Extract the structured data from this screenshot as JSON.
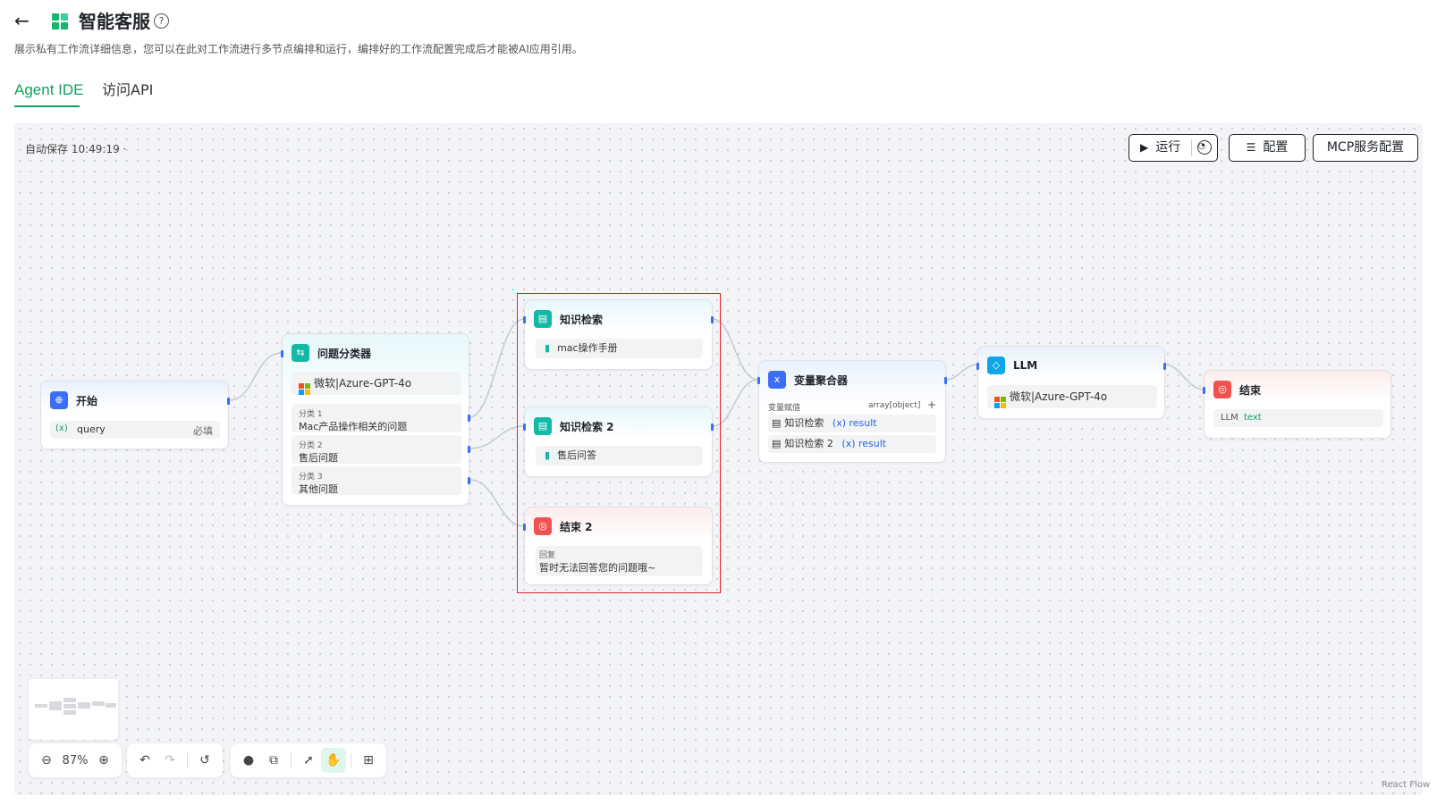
{
  "header": {
    "back_label": "←",
    "title": "智能客服",
    "help_label": "?",
    "description": "展示私有工作流详细信息，您可以在此对工作流进行多节点编排和运行，编排好的工作流配置完成后才能被AI应用引用。"
  },
  "tabs": [
    {
      "label": "Agent IDE",
      "active": true
    },
    {
      "label": "访问API",
      "active": false
    }
  ],
  "canvas": {
    "autosave": "自动保存 10:49:19 ·",
    "toolbar": {
      "run_label": "运行",
      "config_label": "配置",
      "mcp_label": "MCP服务配置"
    }
  },
  "nodes": {
    "start": {
      "title": "开始",
      "var_icon": "(x)",
      "var_name": "query",
      "required": "必填"
    },
    "classifier": {
      "title": "问题分类器",
      "model": "微软|Azure-GPT-4o",
      "classes": [
        {
          "label": "分类 1",
          "value": "Mac产品操作相关的问题"
        },
        {
          "label": "分类 2",
          "value": "售后问题"
        },
        {
          "label": "分类 3",
          "value": "其他问题"
        }
      ]
    },
    "kb1": {
      "title": "知识检索",
      "dataset": "mac操作手册"
    },
    "kb2": {
      "title": "知识检索 2",
      "dataset": "售后问答"
    },
    "end2": {
      "title": "结束 2",
      "reply_label": "回复",
      "reply_value": "暂时无法回答您的问题哦~"
    },
    "aggregator": {
      "title": "变量聚合器",
      "assign_label": "变量赋值",
      "type_label": "array[object]",
      "add_label": "+",
      "items": [
        {
          "source": "知识检索",
          "var": "(x) result"
        },
        {
          "source": "知识检索 2",
          "var": "(x) result"
        }
      ]
    },
    "llm": {
      "title": "LLM",
      "model": "微软|Azure-GPT-4o"
    },
    "end": {
      "title": "结束",
      "out_source": "LLM",
      "out_var": "text"
    }
  },
  "controls": {
    "zoom": "87%"
  },
  "attribution": "React Flow",
  "colors": {
    "accent": "#12a05c",
    "port": "#3b6ef5",
    "selection": "#e02424"
  }
}
